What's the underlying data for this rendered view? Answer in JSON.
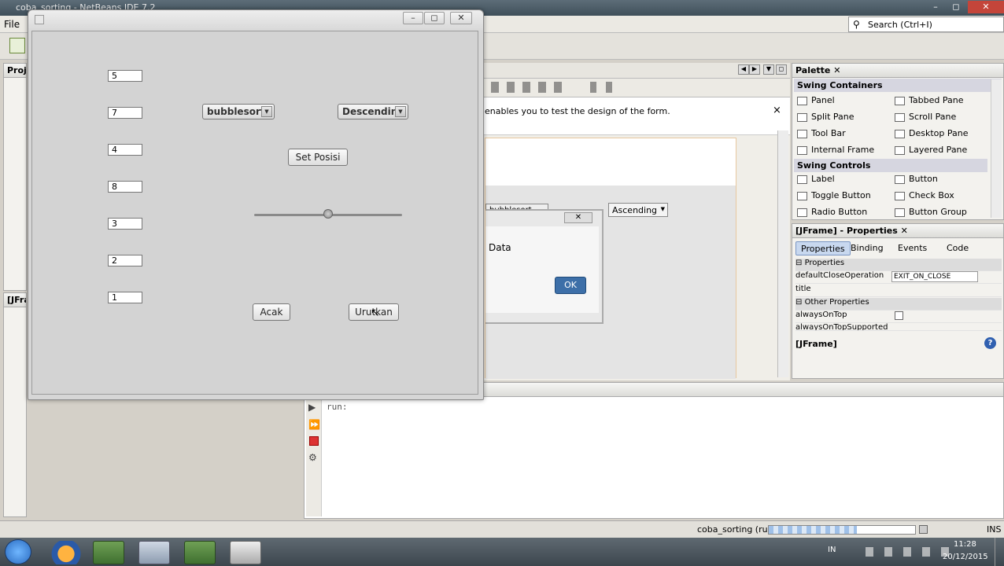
{
  "ide": {
    "title": "coba_sorting - NetBeans IDE 7.2",
    "menu": [
      "File"
    ],
    "search_placeholder": "Search (Ctrl+I)"
  },
  "panels": {
    "projects_label": "Proje",
    "navigator_label": "[JFrame]",
    "hint_text": "enables you to test the design of the form.",
    "hint_close": "×"
  },
  "palette": {
    "title": "Palette",
    "categories": [
      {
        "name": "Swing Containers",
        "items": [
          "Panel",
          "Tabbed Pane",
          "Split Pane",
          "Scroll Pane",
          "Tool Bar",
          "Desktop Pane",
          "Internal Frame",
          "Layered Pane"
        ]
      },
      {
        "name": "Swing Controls",
        "items": [
          "Label",
          "Button",
          "Toggle Button",
          "Check Box",
          "Radio Button",
          "Button Group"
        ]
      }
    ]
  },
  "properties": {
    "title": "[JFrame] - Properties",
    "tabs": [
      "Properties",
      "Binding",
      "Events",
      "Code"
    ],
    "sections": [
      "Properties",
      "Other Properties"
    ],
    "rows": [
      {
        "name": "defaultCloseOperation",
        "value": "EXIT_ON_CLOSE"
      },
      {
        "name": "title",
        "value": ""
      },
      {
        "name": "alwaysOnTop",
        "value": ""
      },
      {
        "name": "alwaysOnTopSupported",
        "value": ""
      }
    ],
    "footer": "[JFrame]"
  },
  "designer": {
    "combo_algo": "bubblesort",
    "combo_order": "Ascending",
    "dialog_text": "Data",
    "dialog_ok": "OK"
  },
  "output": {
    "text": "run:"
  },
  "status": {
    "task": "coba_sorting (run)",
    "mode": "INS"
  },
  "taskbar": {
    "lang": "IN",
    "time": "11:28",
    "date": "20/12/2015"
  },
  "app": {
    "fields": [
      "5",
      "7",
      "4",
      "8",
      "3",
      "2",
      "1"
    ],
    "combo_algo": "bubblesort",
    "combo_order": "Descending",
    "set_button": "Set Posisi",
    "shuffle_button": "Acak",
    "sort_button": "Urutkan",
    "slider_value": 0.5
  },
  "colors": {
    "accent": "#2f6db5",
    "ok_button": "#3d6fa8"
  }
}
